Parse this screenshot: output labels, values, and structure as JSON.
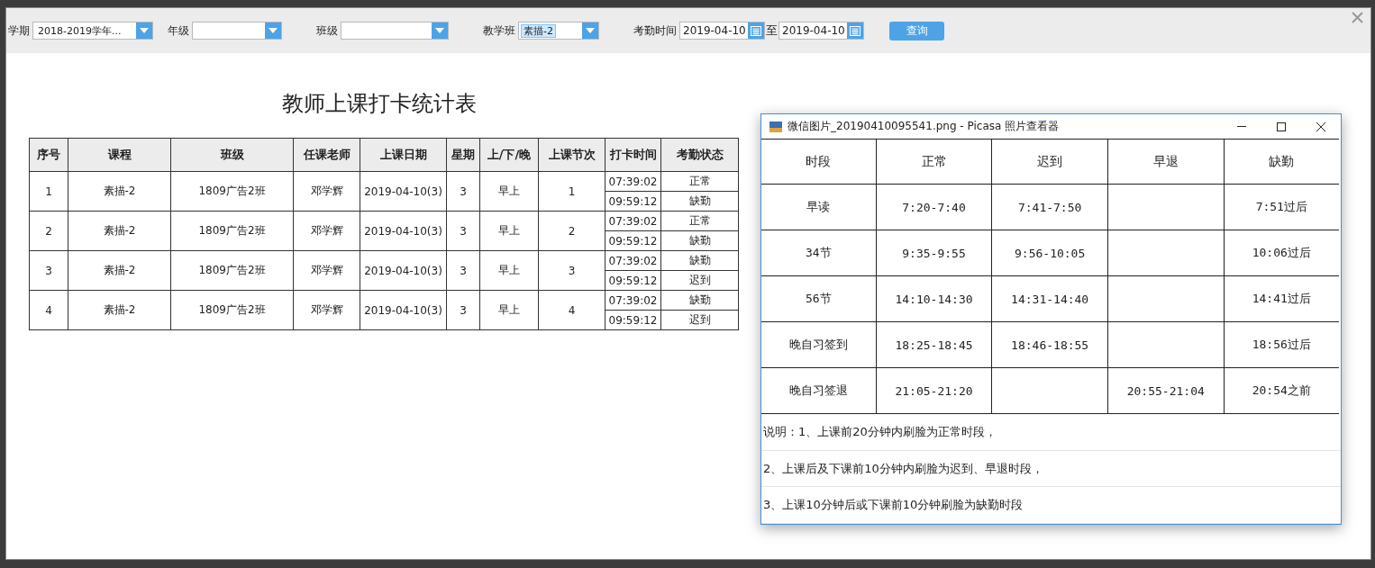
{
  "filters": [
    {
      "kind": "select",
      "label": "学期",
      "value": "2018-2019学年...",
      "text_selected": false
    },
    {
      "kind": "select",
      "label": "年级"
    },
    {
      "kind": "select",
      "label": "班级"
    },
    {
      "kind": "select",
      "label": "教学班",
      "value": "素描-2",
      "text_selected": true
    },
    {
      "kind": "daterange",
      "label": "考勤时间",
      "from": "2019-04-10",
      "separator": "至",
      "to": "2019-04-10"
    }
  ],
  "query_button": "查询",
  "report": {
    "title": "教师上课打卡统计表",
    "columns": [
      "序号",
      "课程",
      "班级",
      "任课老师",
      "上课日期",
      "星期",
      "上/下/晚",
      "上课节次",
      "打卡时间",
      "考勤状态"
    ],
    "rows": [
      {
        "no": "1",
        "course": "素描-2",
        "class": "1809广告2班",
        "teacher": "邓学辉",
        "date": "2019-04-10(3)",
        "weekday": "3",
        "session": "早上",
        "lesson": "1",
        "punches": [
          {
            "time": "07:39:02",
            "status": "正常"
          },
          {
            "time": "09:59:12",
            "status": "缺勤"
          }
        ]
      },
      {
        "no": "2",
        "course": "素描-2",
        "class": "1809广告2班",
        "teacher": "邓学辉",
        "date": "2019-04-10(3)",
        "weekday": "3",
        "session": "早上",
        "lesson": "2",
        "punches": [
          {
            "time": "07:39:02",
            "status": "正常"
          },
          {
            "time": "09:59:12",
            "status": "缺勤"
          }
        ]
      },
      {
        "no": "3",
        "course": "素描-2",
        "class": "1809广告2班",
        "teacher": "邓学辉",
        "date": "2019-04-10(3)",
        "weekday": "3",
        "session": "早上",
        "lesson": "3",
        "punches": [
          {
            "time": "07:39:02",
            "status": "缺勤"
          },
          {
            "time": "09:59:12",
            "status": "迟到"
          }
        ]
      },
      {
        "no": "4",
        "course": "素描-2",
        "class": "1809广告2班",
        "teacher": "邓学辉",
        "date": "2019-04-10(3)",
        "weekday": "3",
        "session": "早上",
        "lesson": "4",
        "punches": [
          {
            "time": "07:39:02",
            "status": "缺勤"
          },
          {
            "time": "09:59:12",
            "status": "迟到"
          }
        ]
      }
    ]
  },
  "viewer": {
    "title": "微信图片_20190410095541.png - Picasa 照片查看器",
    "columns": [
      "时段",
      "正常",
      "迟到",
      "早退",
      "缺勤"
    ],
    "rows": [
      [
        "早读",
        "7:20-7:40",
        "7:41-7:50",
        "",
        "7:51过后"
      ],
      [
        "34节",
        "9:35-9:55",
        "9:56-10:05",
        "",
        "10:06过后"
      ],
      [
        "56节",
        "14:10-14:30",
        "14:31-14:40",
        "",
        "14:41过后"
      ],
      [
        "晚自习签到",
        "18:25-18:45",
        "18:46-18:55",
        "",
        "18:56过后"
      ],
      [
        "晚自习签退",
        "21:05-21:20",
        "",
        "20:55-21:04",
        "20:54之前"
      ]
    ],
    "notes": [
      "说明：1、上课前20分钟内刷脸为正常时段，",
      "2、上课后及下课前10分钟内刷脸为迟到、早退时段，",
      "3、上课10分钟后或下课前10分钟刷脸为缺勤时段"
    ]
  }
}
